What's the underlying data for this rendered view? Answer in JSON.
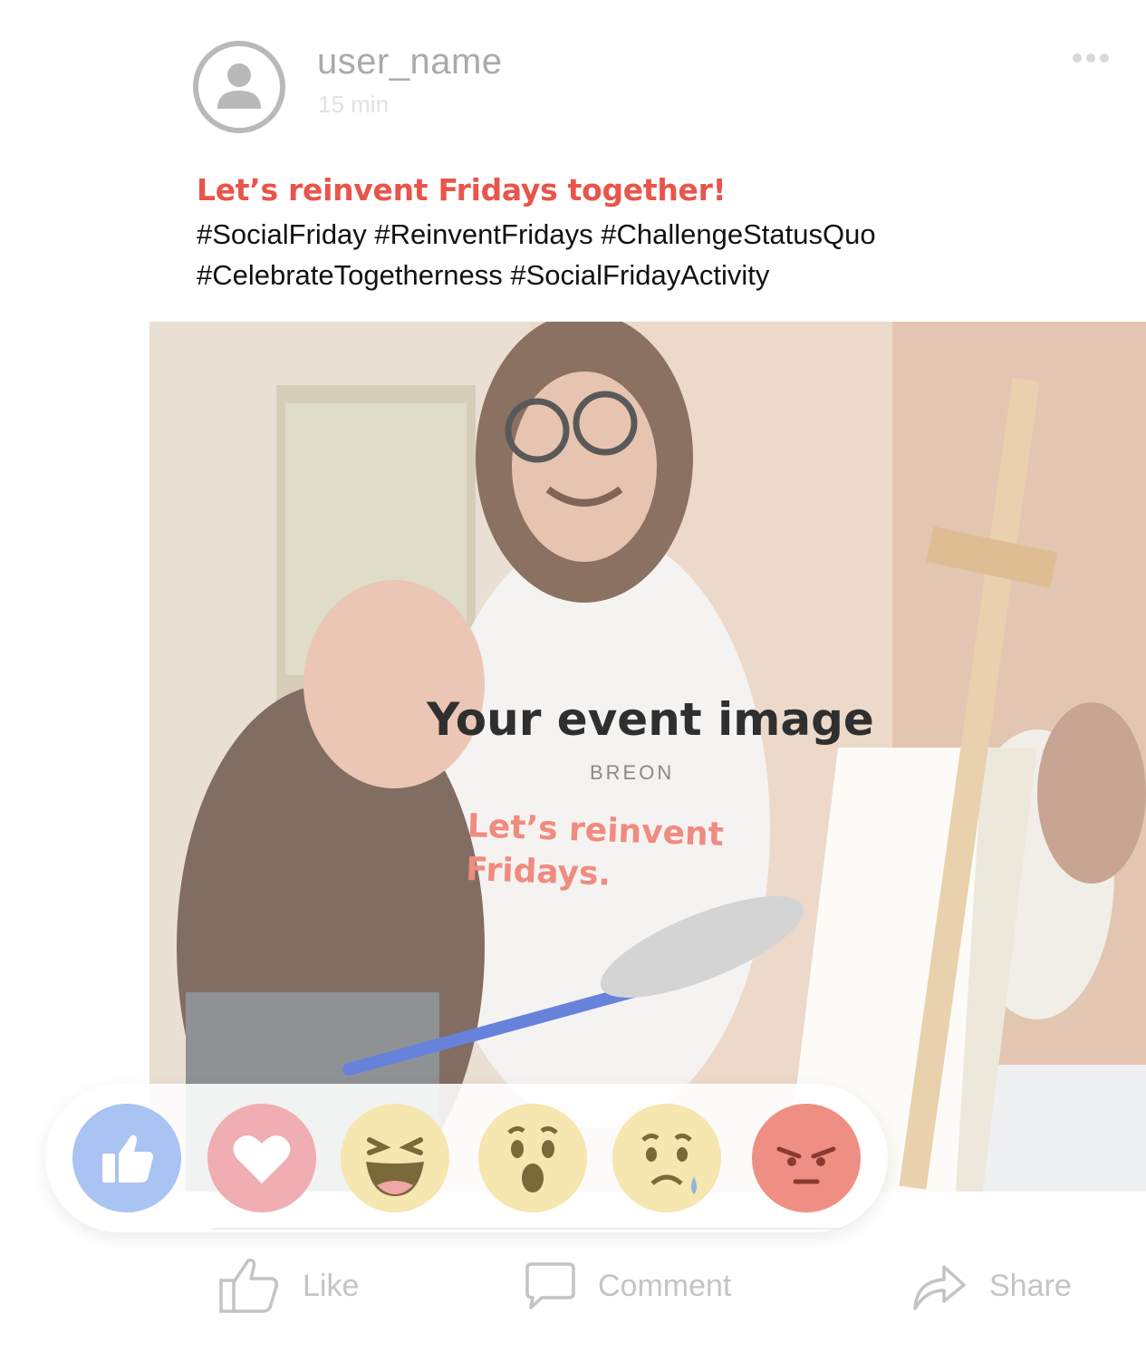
{
  "post": {
    "username": "user_name",
    "time": "15 min",
    "title": "Let’s reinvent Fridays together!",
    "hashtags_line1": "#SocialFriday #ReinventFridays #ChallengeStatusQuo",
    "hashtags_line2": "#CelebrateTogetherness #SocialFridayActivity"
  },
  "image": {
    "caption": "Your event image",
    "shirt_brand": "BREON",
    "shirt_line1": "Let’s reinvent",
    "shirt_line2": "Fridays."
  },
  "reactions": [
    "like",
    "love",
    "haha",
    "wow",
    "sad",
    "angry"
  ],
  "actions": {
    "like_label": "Like",
    "comment_label": "Comment",
    "share_label": "Share"
  },
  "colors": {
    "accent": "#e8554a",
    "muted_text": "#c4c4c4",
    "like_blue": "#a9c3f2",
    "love_pink": "#f0aeb2",
    "emoji_yellow": "#f6e6b0",
    "angry_red": "#ef8f83"
  }
}
